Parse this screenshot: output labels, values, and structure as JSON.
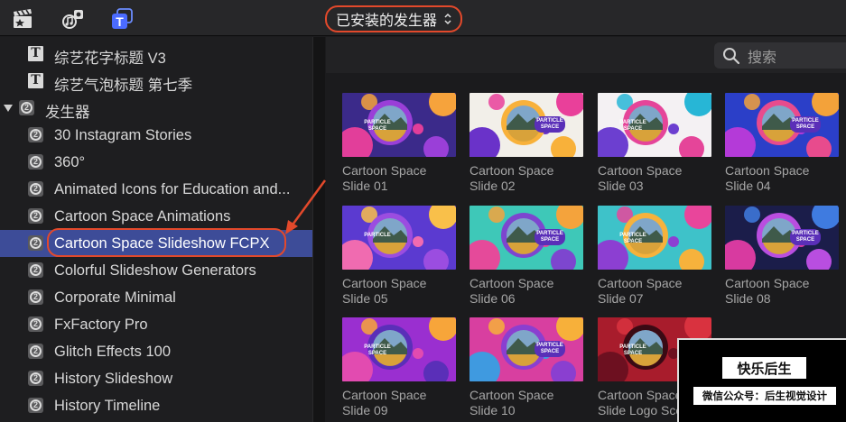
{
  "toolbar": {
    "icons": [
      "clapper-icon",
      "music-photo-icon",
      "titles-generators-icon"
    ],
    "dropdown_label": "已安装的发生器",
    "accent": "#e3492b"
  },
  "sidebar": {
    "items": [
      {
        "label": "综艺花字标题 V3",
        "icon": "title-icon",
        "indent": 1
      },
      {
        "label": "综艺气泡标题 第七季",
        "icon": "title-icon",
        "indent": 1
      },
      {
        "label": "发生器",
        "icon": "generator-icon",
        "indent": 0,
        "expanded": true
      },
      {
        "label": "30 Instagram Stories",
        "icon": "generator-icon",
        "indent": 1
      },
      {
        "label": "360°",
        "icon": "generator-icon",
        "indent": 1
      },
      {
        "label": "Animated Icons for Education and...",
        "icon": "generator-icon",
        "indent": 1
      },
      {
        "label": "Cartoon Space Animations",
        "icon": "generator-icon",
        "indent": 1
      },
      {
        "label": "Cartoon Space Slideshow FCPX",
        "icon": "generator-icon",
        "indent": 1,
        "selected": true
      },
      {
        "label": "Colorful Slideshow Generators",
        "icon": "generator-icon",
        "indent": 1
      },
      {
        "label": "Corporate Minimal",
        "icon": "generator-icon",
        "indent": 1
      },
      {
        "label": "FxFactory Pro",
        "icon": "generator-icon",
        "indent": 1
      },
      {
        "label": "Glitch Effects 100",
        "icon": "generator-icon",
        "indent": 1
      },
      {
        "label": "History Slideshow",
        "icon": "generator-icon",
        "indent": 1
      },
      {
        "label": "History Timeline",
        "icon": "generator-icon",
        "indent": 1
      }
    ],
    "selected_color": "#3d4c98"
  },
  "search": {
    "placeholder": "搜索"
  },
  "thumbnails": [
    {
      "line1": "Cartoon Space",
      "line2": "Slide 01",
      "badge": "PARTICLE SPACE"
    },
    {
      "line1": "Cartoon Space",
      "line2": "Slide 02",
      "badge": "PARTICLE SPACE"
    },
    {
      "line1": "Cartoon Space",
      "line2": "Slide 03",
      "badge": "PARTICLE SPACE"
    },
    {
      "line1": "Cartoon Space",
      "line2": "Slide 04",
      "badge": "PARTICLE SPACE"
    },
    {
      "line1": "Cartoon Space",
      "line2": "Slide 05",
      "badge": "PARTICLE"
    },
    {
      "line1": "Cartoon Space",
      "line2": "Slide 06",
      "badge": "PARTICLE SPACE"
    },
    {
      "line1": "Cartoon Space",
      "line2": "Slide 07",
      "badge": "PARTICLE SPACE"
    },
    {
      "line1": "Cartoon Space",
      "line2": "Slide 08",
      "badge": "PARTICLE SPACE"
    },
    {
      "line1": "Cartoon Space",
      "line2": "Slide 09",
      "badge": "PARTICLE SPACE"
    },
    {
      "line1": "Cartoon Space",
      "line2": "Slide 10",
      "badge": "PARTICLE SPACE"
    },
    {
      "line1": "Cartoon Space",
      "line2": "Slide Logo Scene",
      "badge": "PARTICLE SPACE"
    }
  ],
  "watermark": {
    "title": "快乐后生",
    "subtitle": "微信公众号：后生视觉设计"
  }
}
